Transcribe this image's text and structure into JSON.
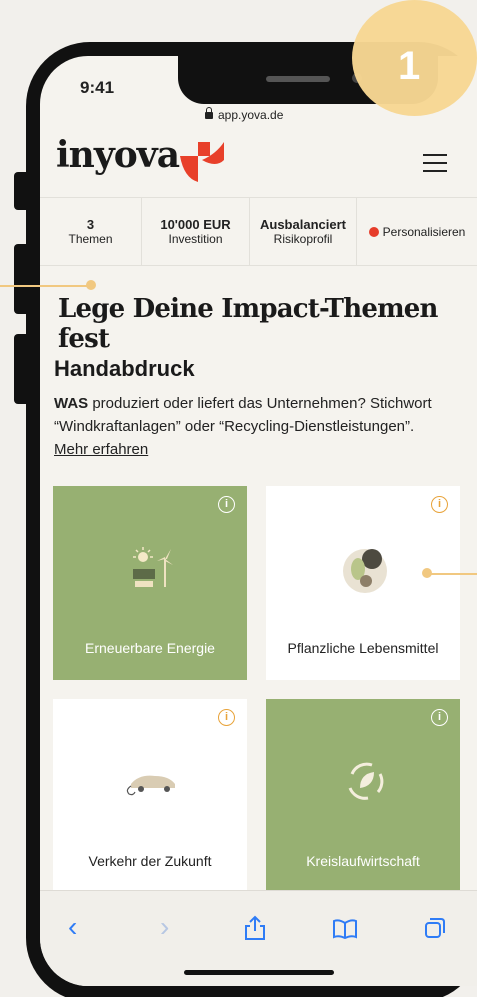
{
  "status_bar": {
    "time": "9:41"
  },
  "browser": {
    "url": "app.yova.de"
  },
  "header": {
    "logo": "inyova",
    "menu_icon": "hamburger-icon"
  },
  "stats": [
    {
      "value": "3",
      "label": "Themen"
    },
    {
      "value": "10'000 EUR",
      "label": "Investition"
    },
    {
      "value": "Ausbalanciert",
      "label": "Risikoprofil"
    }
  ],
  "personalize_label": "Personalisieren",
  "page_title": "Lege Deine Impact-Themen fest",
  "section": {
    "title": "Handabdruck",
    "desc_bold": "WAS",
    "desc_rest": " produziert oder liefert das Unternehmen? Stichwort “Windkraftanlagen” oder “Recycling-Dienstleistungen”.",
    "more_link": "Mehr erfahren"
  },
  "cards": [
    {
      "label": "Erneuerbare Energie",
      "selected": true,
      "icon": "renewable-energy-icon"
    },
    {
      "label": "Pflanzliche Lebensmittel",
      "selected": false,
      "icon": "plant-food-icon"
    },
    {
      "label": "Verkehr der Zukunft",
      "selected": false,
      "icon": "electric-car-icon"
    },
    {
      "label": "Kreislaufwirtschaft",
      "selected": true,
      "icon": "recycling-icon"
    }
  ],
  "colors": {
    "selected_card": "#97b072",
    "info_icon": "#e8a33a",
    "badge": "#f7d793",
    "personalize_dot": "#e63c2a"
  },
  "step_badge": "1",
  "toolbar_icons": [
    "back-icon",
    "forward-icon",
    "share-icon",
    "bookmarks-icon",
    "tabs-icon"
  ]
}
